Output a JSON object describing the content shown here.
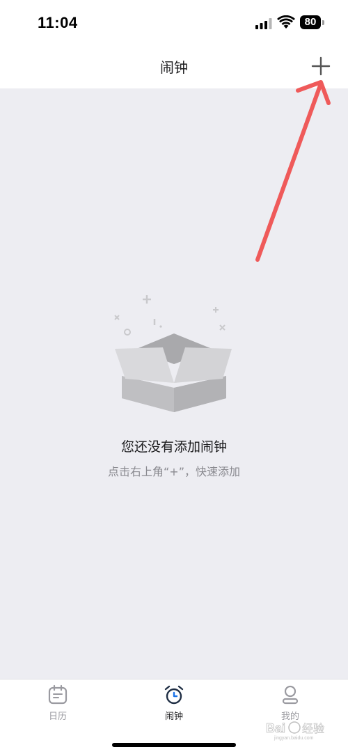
{
  "status_bar": {
    "time": "11:04",
    "battery": "80"
  },
  "nav": {
    "title": "闹钟"
  },
  "empty_state": {
    "title": "您还没有添加闹钟",
    "hint": "点击右上角“+”，快速添加"
  },
  "tabs": [
    {
      "label": "日历",
      "icon": "calendar-icon",
      "active": false
    },
    {
      "label": "闹钟",
      "icon": "alarm-clock-icon",
      "active": true
    },
    {
      "label": "我的",
      "icon": "profile-icon",
      "active": false
    }
  ],
  "watermark": {
    "text": "Baidu经验",
    "subtext": "jingyan.baidu.com"
  },
  "colors": {
    "annotation_arrow": "#ef5a5a",
    "background": "#ededf2",
    "active_tab": "#1c1c1e",
    "inactive_tab": "#9a9aa0"
  }
}
